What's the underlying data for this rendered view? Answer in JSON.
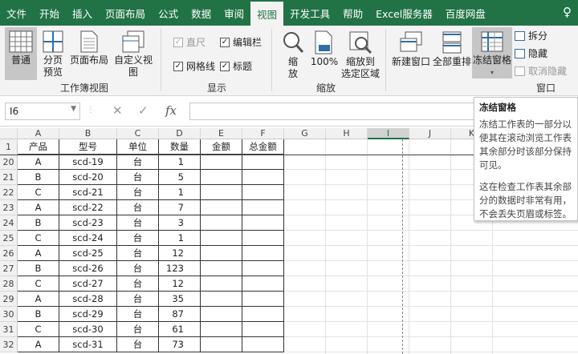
{
  "tabs": [
    "文件",
    "开始",
    "插入",
    "页面布局",
    "公式",
    "数据",
    "审阅",
    "视图",
    "开发工具",
    "帮助",
    "Excel服务器",
    "百度网盘"
  ],
  "active_tab": "视图",
  "ribbon": {
    "workbook_views": {
      "normal": "普通",
      "page_break_l1": "分页",
      "page_break_l2": "预览",
      "page_layout": "页面布局",
      "custom": "自定义视图",
      "group": "工作簿视图"
    },
    "show": {
      "ruler": "直尺",
      "gridlines": "网格线",
      "formula_bar": "编辑栏",
      "headings": "标题",
      "group": "显示"
    },
    "zoom": {
      "zoom_l1": "缩",
      "zoom_l2": "放",
      "hundred": "100%",
      "zoom_sel_l1": "缩放到",
      "zoom_sel_l2": "选定区域",
      "group": "缩放"
    },
    "window": {
      "new_window": "新建窗口",
      "arrange": "全部重排",
      "freeze": "冻结窗格",
      "split": "拆分",
      "hide": "隐藏",
      "unhide": "取消隐藏",
      "group": "窗口"
    }
  },
  "formula_bar": {
    "name_box": "I6",
    "cancel": "✕",
    "enter": "✓",
    "fx": "fx"
  },
  "columns": [
    "A",
    "B",
    "C",
    "D",
    "E",
    "F",
    "G",
    "H",
    "I",
    "J",
    "K"
  ],
  "selected_column": "I",
  "header_row": {
    "row": "1",
    "cells": [
      "产品",
      "型号",
      "单位",
      "数量",
      "金额",
      "总金额"
    ]
  },
  "rows": [
    {
      "row": "20",
      "cells": [
        "A",
        "scd-19",
        "台",
        "1"
      ]
    },
    {
      "row": "21",
      "cells": [
        "B",
        "scd-20",
        "台",
        "5"
      ]
    },
    {
      "row": "22",
      "cells": [
        "C",
        "scd-21",
        "台",
        "1"
      ]
    },
    {
      "row": "23",
      "cells": [
        "A",
        "scd-22",
        "台",
        "7"
      ]
    },
    {
      "row": "24",
      "cells": [
        "B",
        "scd-23",
        "台",
        "3"
      ]
    },
    {
      "row": "25",
      "cells": [
        "C",
        "scd-24",
        "台",
        "1"
      ]
    },
    {
      "row": "26",
      "cells": [
        "A",
        "scd-25",
        "台",
        "12"
      ]
    },
    {
      "row": "27",
      "cells": [
        "B",
        "scd-26",
        "台",
        "123"
      ]
    },
    {
      "row": "28",
      "cells": [
        "C",
        "scd-27",
        "台",
        "12"
      ]
    },
    {
      "row": "29",
      "cells": [
        "A",
        "scd-28",
        "台",
        "35"
      ]
    },
    {
      "row": "30",
      "cells": [
        "B",
        "scd-29",
        "台",
        "87"
      ]
    },
    {
      "row": "31",
      "cells": [
        "C",
        "scd-30",
        "台",
        "61"
      ]
    },
    {
      "row": "32",
      "cells": [
        "A",
        "scd-31",
        "台",
        "73"
      ]
    }
  ],
  "tooltip": {
    "title": "冻结窗格",
    "para1": "冻结工作表的一部分以使其在滚动浏览工作表其余部分时该部分保持可见。",
    "para2": "这在检查工作表其余部分的数据时非常有用，不会丢失页眉或标签。"
  },
  "colors": {
    "excel_green": "#217346",
    "ribbon_bg": "#f3f3f3"
  }
}
